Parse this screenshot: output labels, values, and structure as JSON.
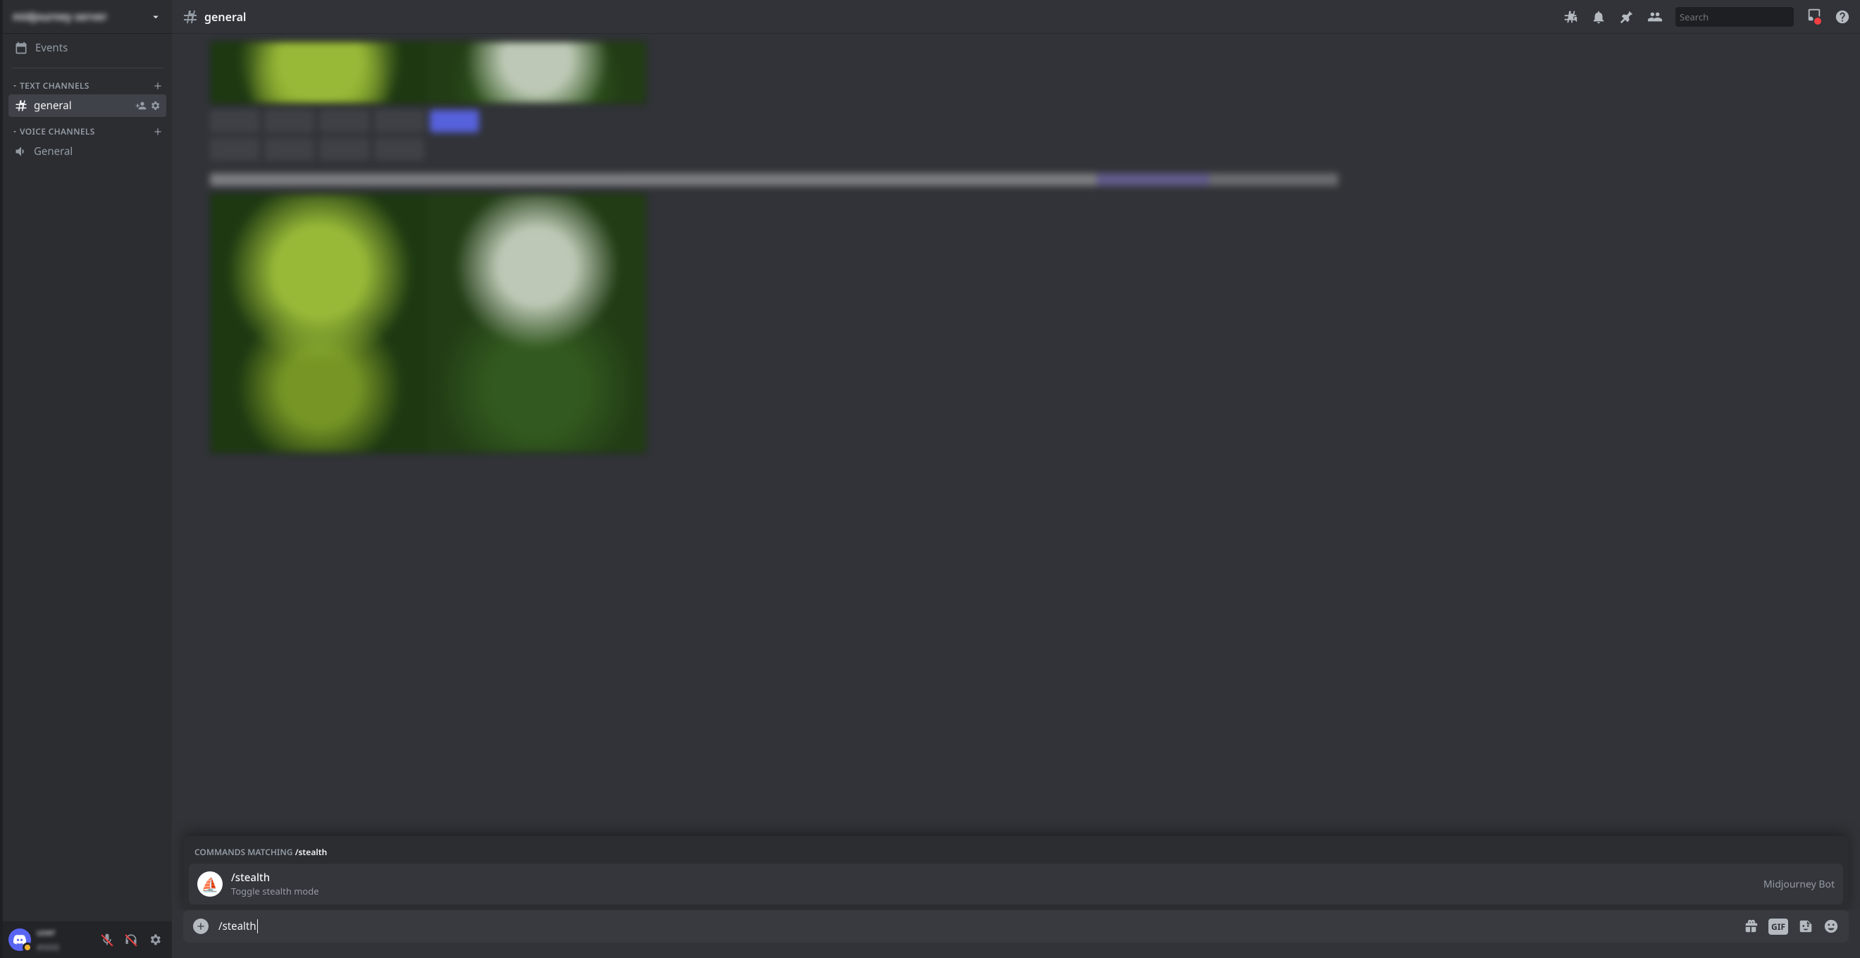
{
  "server": {
    "name": "midjourney server"
  },
  "sidebar": {
    "events_label": "Events",
    "categories": [
      {
        "label": "Text Channels",
        "channels": [
          {
            "name": "general",
            "active": true
          }
        ]
      },
      {
        "label": "Voice Channels",
        "channels": [
          {
            "name": "General",
            "active": false
          }
        ]
      }
    ]
  },
  "user_panel": {
    "name": "user",
    "tag": "#0000"
  },
  "header": {
    "channel_name": "general",
    "search_placeholder": "Search"
  },
  "chat_preview": {
    "prompt_text": "person hiding his images, pop art, v6, green and black color, --ar 16:9"
  },
  "autocomplete": {
    "heading_prefix": "COMMANDS MATCHING ",
    "heading_query": "/stealth",
    "item": {
      "command": "/stealth",
      "description": "Toggle stealth mode",
      "source": "Midjourney Bot",
      "avatar_glyph": "⛵"
    }
  },
  "input": {
    "value": "/stealth"
  }
}
